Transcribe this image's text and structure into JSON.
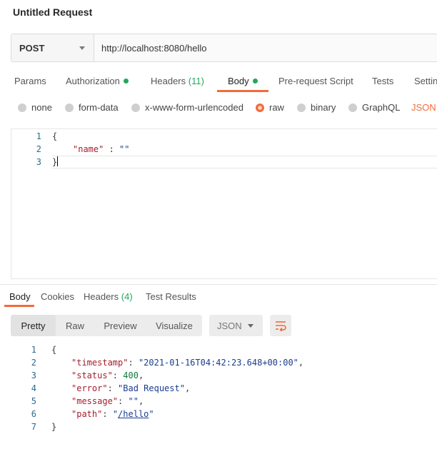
{
  "request": {
    "title": "Untitled Request",
    "method": "POST",
    "url": "http://localhost:8080/hello"
  },
  "request_tabs": [
    {
      "label": "Params"
    },
    {
      "label": "Authorization",
      "dot": true
    },
    {
      "label": "Headers",
      "count": "(11)"
    },
    {
      "label": "Body",
      "dot": true,
      "active": true
    },
    {
      "label": "Pre-request Script"
    },
    {
      "label": "Tests"
    },
    {
      "label": "Settings"
    }
  ],
  "body_types": [
    {
      "label": "none"
    },
    {
      "label": "form-data"
    },
    {
      "label": "x-www-form-urlencoded"
    },
    {
      "label": "raw",
      "selected": true
    },
    {
      "label": "binary"
    },
    {
      "label": "GraphQL"
    }
  ],
  "body_format": "JSON",
  "request_body": {
    "line_numbers": [
      "1",
      "2",
      "3"
    ],
    "open_brace": "{",
    "key": "\"name\"",
    "sep": " : ",
    "value": "\"\"",
    "close_brace": "}"
  },
  "response_tabs": [
    {
      "label": "Body",
      "active": true
    },
    {
      "label": "Cookies"
    },
    {
      "label": "Headers",
      "count": "(4)"
    },
    {
      "label": "Test Results"
    }
  ],
  "view_modes": [
    "Pretty",
    "Raw",
    "Preview",
    "Visualize"
  ],
  "response_format": "JSON",
  "response_body": {
    "line_numbers": [
      "1",
      "2",
      "3",
      "4",
      "5",
      "6",
      "7"
    ],
    "open_brace": "{",
    "close_brace": "}",
    "fields": [
      {
        "key": "\"timestamp\"",
        "value": "\"2021-01-16T04:42:23.648+00:00\"",
        "type": "string",
        "trail": ","
      },
      {
        "key": "\"status\"",
        "value": "400",
        "type": "number",
        "trail": ","
      },
      {
        "key": "\"error\"",
        "value": "\"Bad Request\"",
        "type": "string",
        "trail": ","
      },
      {
        "key": "\"message\"",
        "value": "\"\"",
        "type": "string",
        "trail": ","
      },
      {
        "key": "\"path\"",
        "value_prefix": "\"",
        "value_link": "/hello",
        "value_suffix": "\"",
        "type": "link",
        "trail": ""
      }
    ]
  },
  "colors": {
    "accent": "#f26b3a",
    "status_dot": "#26a65b",
    "json_key": "#a51d2d",
    "json_string": "#1a3d8f",
    "line_number": "#2b6a8e"
  }
}
